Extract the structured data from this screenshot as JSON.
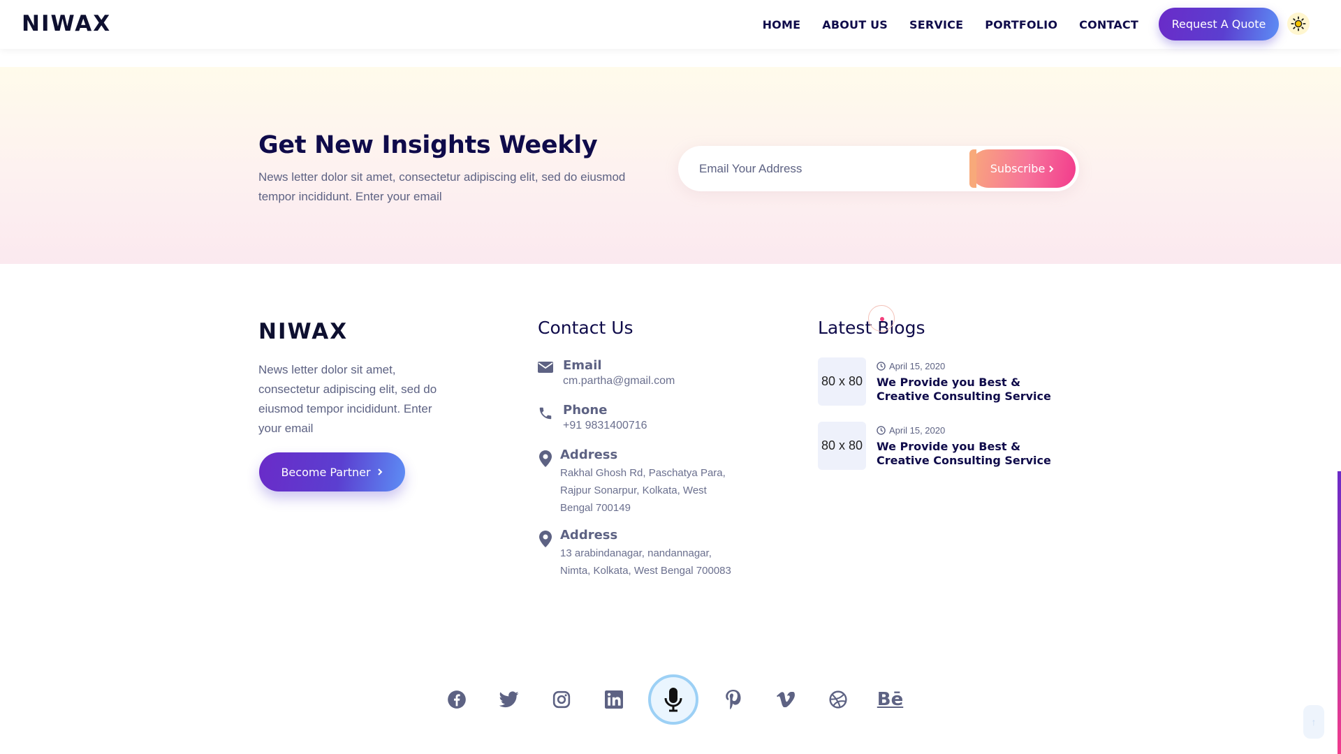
{
  "brand": {
    "logo": "NIWAX"
  },
  "nav": {
    "items": [
      "HOME",
      "ABOUT US",
      "SERVICE",
      "PORTFOLIO",
      "CONTACT"
    ],
    "quote_button": "Request A Quote"
  },
  "newsletter": {
    "title": "Get New Insights Weekly",
    "text": "News letter dolor sit amet, consectetur adipiscing elit, sed do eiusmod tempor incididunt. Enter your email",
    "email_placeholder": "Email Your Address",
    "subscribe_label": "Subscribe"
  },
  "footer": {
    "about_text": "News letter dolor sit amet, consectetur adipiscing elit, sed do eiusmod tempor incididunt. Enter your email",
    "partner_button": "Become Partner",
    "contact": {
      "title": "Contact Us",
      "email_label": "Email",
      "email_value": "cm.partha@gmail.com",
      "phone_label": "Phone",
      "phone_value": "+91 9831400716",
      "address1_label": "Address",
      "address1_value": "Rakhal Ghosh Rd, Paschatya Para, Rajpur Sonarpur, Kolkata, West Bengal 700149",
      "address2_label": "Address",
      "address2_value": "13 arabindanagar, nandannagar, Nimta, Kolkata, West Bengal 700083"
    },
    "blogs": {
      "title": "Latest Blogs",
      "items": [
        {
          "thumb": "80 x 80",
          "date": "April 15, 2020",
          "title": "We Provide you Best & Creative Consulting Service"
        },
        {
          "thumb": "80 x 80",
          "date": "April 15, 2020",
          "title": "We Provide you Best & Creative Consulting Service"
        }
      ]
    },
    "socials": [
      "facebook-icon",
      "twitter-icon",
      "instagram-icon",
      "linkedin-icon",
      "microphone-icon",
      "pinterest-icon",
      "vimeo-icon",
      "dribbble-icon",
      "behance-icon"
    ],
    "behance_text": "Bē"
  },
  "colors": {
    "accent_purple": "#6a2bc8",
    "accent_blue": "#5d8ef5",
    "accent_pink": "#f23b8c",
    "navy": "#0f0b4a"
  }
}
